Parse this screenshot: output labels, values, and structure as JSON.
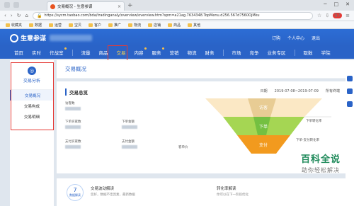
{
  "browser": {
    "tab_title": "交易概况 - 生意参谋",
    "url": "https://sycm.taobao.com/bda/tradinganaly/overview/overview.htm?spm=a21ag.7634348.TopMenu.d256.567d7560OjMku",
    "badge": "97"
  },
  "bookmarks": [
    {
      "label": "收藏夹"
    },
    {
      "label": "数据"
    },
    {
      "label": "运营"
    },
    {
      "label": "宝贝"
    },
    {
      "label": "客户"
    },
    {
      "label": "推广"
    },
    {
      "label": "物流"
    },
    {
      "label": "店铺"
    },
    {
      "label": "商品"
    },
    {
      "label": "其他"
    }
  ],
  "header": {
    "logo_text": "生意参谋",
    "right": [
      "订购",
      "个人中心",
      "退出"
    ]
  },
  "nav": {
    "items": [
      "首页",
      "实时",
      "作战室",
      "流量",
      "商品",
      "交易",
      "内容",
      "服务",
      "营销",
      "物流",
      "财务",
      "市场",
      "竞争",
      "业务专区",
      "取数",
      "学院"
    ],
    "selected": "交易"
  },
  "sidebar": {
    "title": "交易分析",
    "items": [
      "交易概况",
      "交易构成",
      "交易明细"
    ],
    "active": "交易概况"
  },
  "page": {
    "title": "交易概况"
  },
  "overview": {
    "title": "交易总览",
    "date_label": "日期",
    "date_range": "2019-07-08~2019-07-09",
    "device": "所有终端",
    "metrics": [
      {
        "label": "访客数"
      },
      {
        "label": "下单买家数"
      },
      {
        "label": "下单金额"
      },
      {
        "label": "支付买家数"
      },
      {
        "label": "支付金额"
      },
      {
        "label": "客单价"
      }
    ],
    "funnel": {
      "visit": "访客",
      "order": "下单",
      "pay": "支付",
      "order_rate": "下单转化率",
      "pay_rate": "下单-支付转化率"
    }
  },
  "bottom": {
    "days_num": "7",
    "days_unit": "天",
    "days_sub": "数据解读",
    "trend_title": "交易波动解读",
    "trend_desc": "您好，数据不佳因素，最新数据",
    "conv_title": "转化率解读",
    "conv_desc": "你可以在下一阶段优化"
  },
  "watermark": {
    "big": "百科全说",
    "small": "助你轻松解决"
  }
}
